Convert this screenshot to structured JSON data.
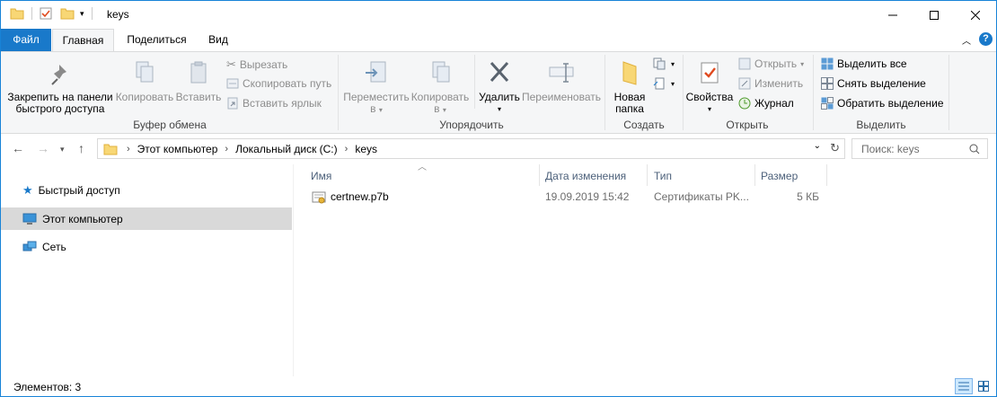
{
  "window": {
    "title": "keys"
  },
  "tabs": {
    "file": "Файл",
    "home": "Главная",
    "share": "Поделиться",
    "view": "Вид"
  },
  "ribbon": {
    "clipboard": {
      "pin": "Закрепить на панели быстрого доступа",
      "pin_l1": "Закрепить на панели",
      "pin_l2": "быстрого доступа",
      "copy": "Копировать",
      "paste": "Вставить",
      "cut": "Вырезать",
      "copy_path": "Скопировать путь",
      "paste_shortcut": "Вставить ярлык",
      "label": "Буфер обмена"
    },
    "organize": {
      "move_l1": "Переместить",
      "move_l2": "в",
      "copy_l1": "Копировать",
      "copy_l2": "в",
      "delete": "Удалить",
      "rename": "Переименовать",
      "label": "Упорядочить"
    },
    "new": {
      "folder_l1": "Новая",
      "folder_l2": "папка",
      "label": "Создать"
    },
    "open": {
      "properties": "Свойства",
      "open": "Открыть",
      "edit": "Изменить",
      "history": "Журнал",
      "label": "Открыть"
    },
    "select": {
      "all": "Выделить все",
      "none": "Снять выделение",
      "invert": "Обратить выделение",
      "label": "Выделить"
    }
  },
  "address": {
    "crumbs": [
      "Этот компьютер",
      "Локальный диск (C:)",
      "keys"
    ],
    "search_placeholder": "Поиск: keys"
  },
  "nav": {
    "items": [
      {
        "label": "Быстрый доступ"
      },
      {
        "label": "Этот компьютер"
      },
      {
        "label": "Сеть"
      }
    ]
  },
  "columns": {
    "name": "Имя",
    "date": "Дата изменения",
    "type": "Тип",
    "size": "Размер"
  },
  "files": [
    {
      "name": "certnew.p7b",
      "date": "19.09.2019 15:42",
      "type": "Сертификаты PK...",
      "size": "5 КБ"
    }
  ],
  "status": {
    "count": "Элементов: 3"
  },
  "colors": {
    "accent": "#1979ca",
    "selection": "#d9d9d9"
  }
}
